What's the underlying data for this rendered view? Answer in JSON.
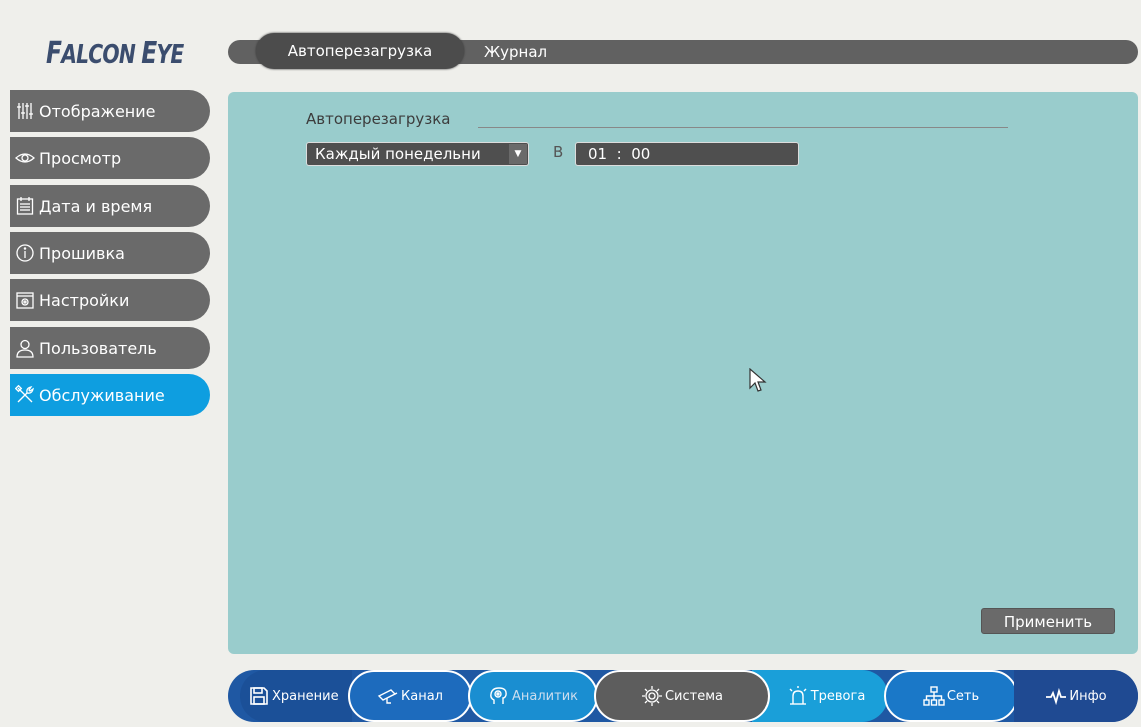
{
  "brand": {
    "logo_text_1": "F",
    "logo_text_2": "ALCON ",
    "logo_text_3": "E",
    "logo_text_4": "YE"
  },
  "top_tabs": [
    {
      "label": "Автоперезагрузка",
      "active": true
    },
    {
      "label": "Журнал",
      "active": false
    }
  ],
  "sidebar": {
    "items": [
      {
        "label": "Отображение",
        "icon": "sliders-icon"
      },
      {
        "label": "Просмотр",
        "icon": "eye-icon"
      },
      {
        "label": "Дата и время",
        "icon": "calendar-icon"
      },
      {
        "label": "Прошивка",
        "icon": "info-icon"
      },
      {
        "label": "Настройки",
        "icon": "settings-folder-icon"
      },
      {
        "label": "Пользователь",
        "icon": "user-icon"
      },
      {
        "label": "Обслуживание",
        "icon": "tools-icon",
        "active": true
      }
    ]
  },
  "autoreboot": {
    "section_title": "Автоперезагрузка",
    "schedule_value": "Каждый понедельни",
    "at_label": "В",
    "time_value": "01  :  00",
    "apply_label": "Применить"
  },
  "bottom_nav": [
    {
      "label": "Хранение",
      "icon": "floppy-icon"
    },
    {
      "label": "Канал",
      "icon": "camera-icon"
    },
    {
      "label": "Аналитик",
      "icon": "brain-icon"
    },
    {
      "label": "Система",
      "icon": "gear-icon",
      "active": true
    },
    {
      "label": "Тревога",
      "icon": "alarm-icon"
    },
    {
      "label": "Сеть",
      "icon": "network-icon"
    },
    {
      "label": "Инфо",
      "icon": "pulse-icon"
    }
  ],
  "colors": {
    "accent": "#0e9ee0",
    "panel_bg": "#99cccc",
    "sidebar_item": "#6a6a6a",
    "nav_blue": "#1f58a3",
    "page_bg": "#efefeb"
  }
}
